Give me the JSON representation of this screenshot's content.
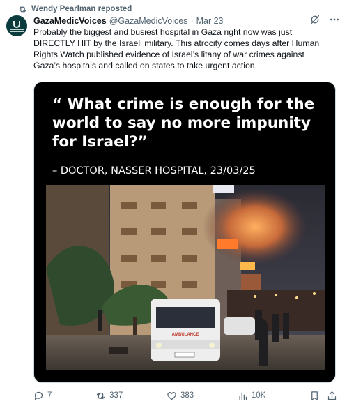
{
  "repost": {
    "label": "Wendy Pearlman reposted",
    "icon": "repost-icon"
  },
  "post": {
    "avatar_icon": "gazamedicvoices-avatar",
    "display_name": "GazaMedicVoices",
    "handle": "@GazaMedicVoices",
    "separator": "·",
    "date": "Mar 23",
    "text": "Probably the biggest and busiest hospital in Gaza right now was just\nDIRECTLY HIT by the Israeli military. This atrocity comes days after Human\nRights Watch published evidence of Israel’s litany of war crimes against\nGaza’s hospitals and called on states to take urgent action."
  },
  "media": {
    "quote": "“ What crime is enough for the world to say no more impunity for Israel?”",
    "attribution": "– DOCTOR, NASSER HOSPITAL, 23/03/25",
    "ambulance_text": "AMBULANCE"
  },
  "actions": {
    "replies": "7",
    "reposts": "337",
    "likes": "383",
    "views": "10K"
  },
  "colors": {
    "text": "#0f1419",
    "muted": "#536471",
    "repost_active": "#536471"
  }
}
